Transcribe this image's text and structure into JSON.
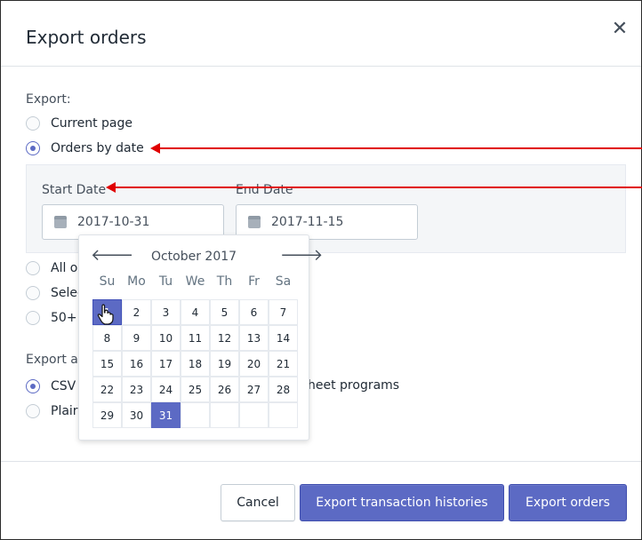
{
  "dialog": {
    "title": "Export orders",
    "close_symbol": "✕"
  },
  "export_section": {
    "label": "Export:",
    "options": [
      {
        "label": "Current page",
        "checked": false
      },
      {
        "label": "Orders by date",
        "checked": true
      },
      {
        "label": "All o",
        "checked": false
      },
      {
        "label": "Selec",
        "checked": false
      },
      {
        "label": "50+",
        "checked": false
      }
    ]
  },
  "date_range": {
    "start_label": "Start Date",
    "start_value": "2017-10-31",
    "end_label": "End Date",
    "end_value": "2017-11-15"
  },
  "export_as": {
    "label": "Export a",
    "options": [
      {
        "label": "CSV",
        "checked": true,
        "trailing": "heet programs"
      },
      {
        "label": "Plair",
        "checked": false
      }
    ]
  },
  "calendar": {
    "prev": "🡐",
    "next": "🡒",
    "month_label": "October 2017",
    "weekdays": [
      "Su",
      "Mo",
      "Tu",
      "We",
      "Th",
      "Fr",
      "Sa"
    ],
    "weeks": [
      [
        "1",
        "2",
        "3",
        "4",
        "5",
        "6",
        "7"
      ],
      [
        "8",
        "9",
        "10",
        "11",
        "12",
        "13",
        "14"
      ],
      [
        "15",
        "16",
        "17",
        "18",
        "19",
        "20",
        "21"
      ],
      [
        "22",
        "23",
        "24",
        "25",
        "26",
        "27",
        "28"
      ],
      [
        "29",
        "30",
        "31",
        "",
        "",
        "",
        ""
      ]
    ],
    "selected_day": "31",
    "hover_day": "1"
  },
  "footer": {
    "cancel_label": "Cancel",
    "export_histories_label": "Export transaction histories",
    "export_orders_label": "Export orders"
  },
  "colors": {
    "accent": "#5c6ac4",
    "annotation": "#e00000"
  }
}
